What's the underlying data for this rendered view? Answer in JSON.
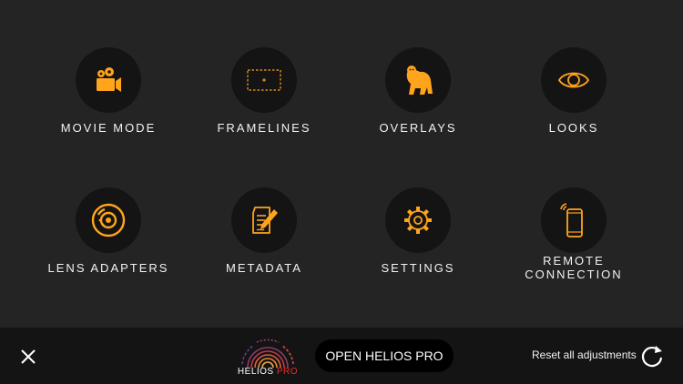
{
  "colors": {
    "accent": "#FFA41B",
    "background": "#242424",
    "circle": "#141414",
    "bar": "#141414"
  },
  "tiles": [
    {
      "label": "MOVIE MODE",
      "icon": "movie-camera-icon"
    },
    {
      "label": "FRAMELINES",
      "icon": "framelines-icon"
    },
    {
      "label": "OVERLAYS",
      "icon": "gorilla-icon"
    },
    {
      "label": "LOOKS",
      "icon": "eye-icon"
    },
    {
      "label": "LENS ADAPTERS",
      "icon": "lens-adapter-icon"
    },
    {
      "label": "METADATA",
      "icon": "metadata-edit-icon"
    },
    {
      "label": "SETTINGS",
      "icon": "gear-icon"
    },
    {
      "label": "REMOTE\nCONNECTION",
      "icon": "remote-phone-icon"
    }
  ],
  "bottom_bar": {
    "close_icon": "close-icon",
    "logo_brand": "HELIOS",
    "logo_suffix": "PRO",
    "open_button": "OPEN HELIOS PRO",
    "reset_label": "Reset all adjustments",
    "reset_icon": "refresh-icon"
  }
}
